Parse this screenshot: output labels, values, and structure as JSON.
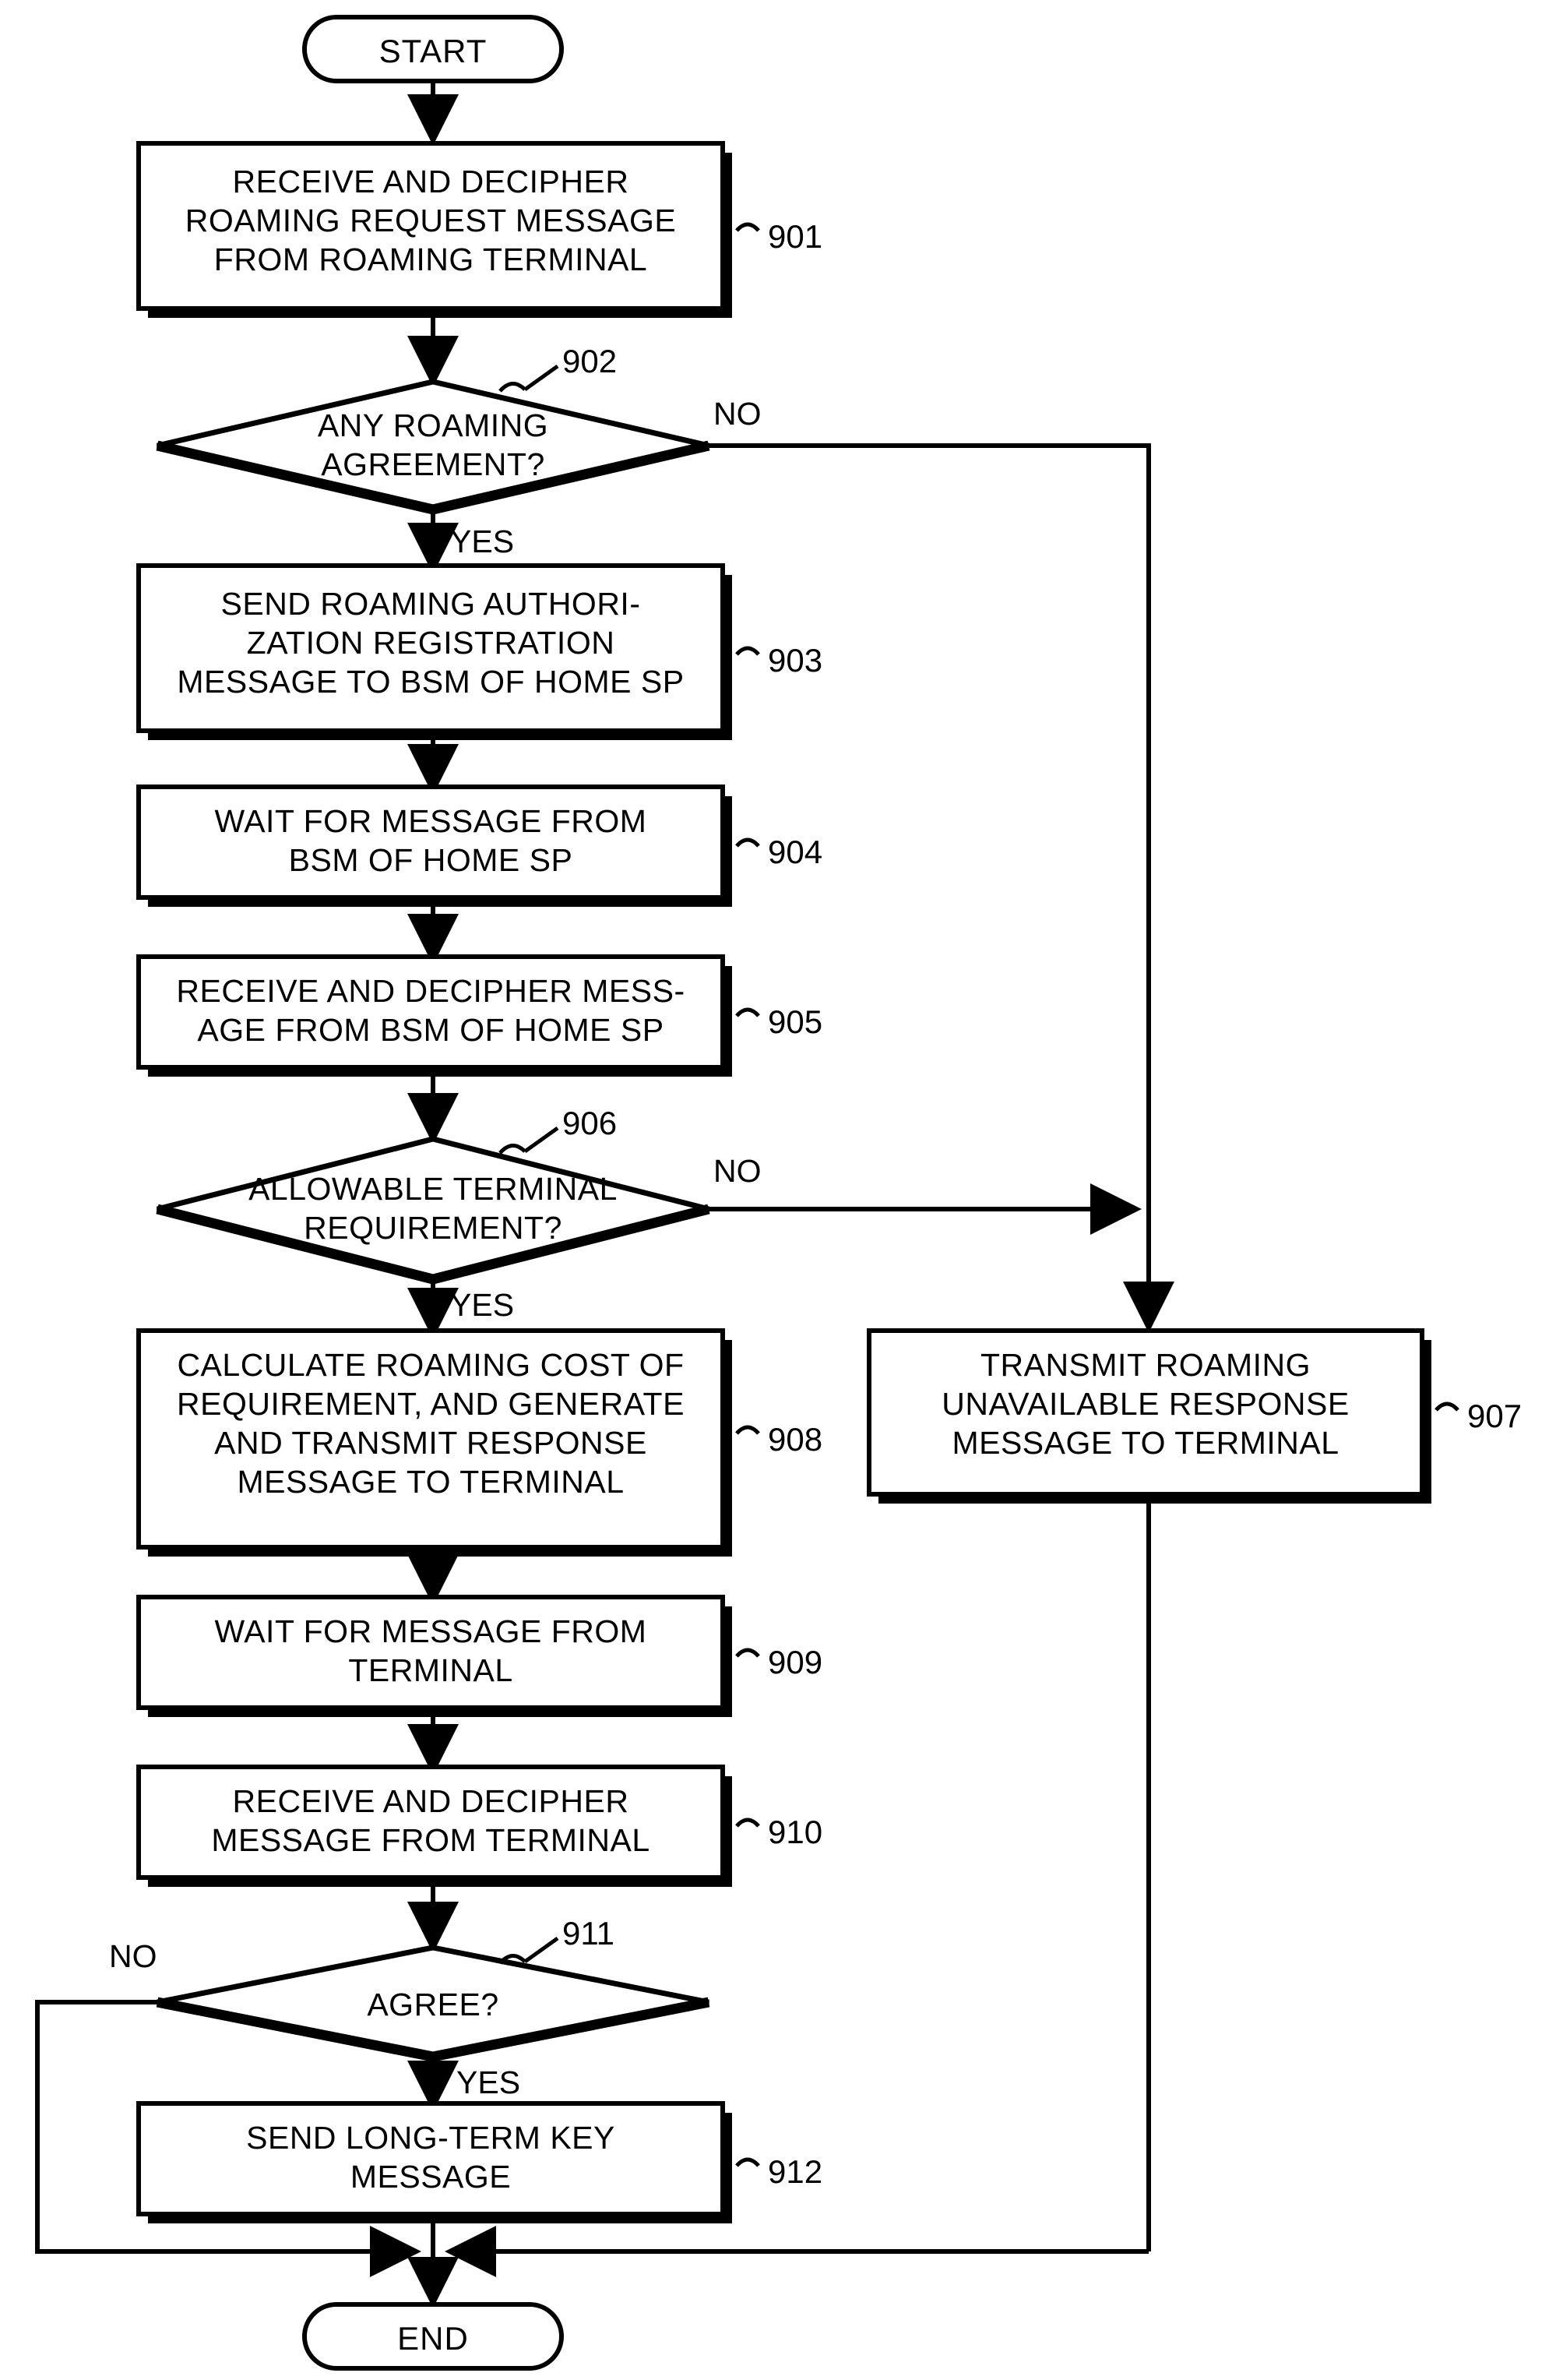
{
  "diagram": {
    "type": "flowchart",
    "title": "",
    "nodes": [
      {
        "id": "start",
        "shape": "terminator",
        "text": "START"
      },
      {
        "id": "n901",
        "shape": "process",
        "text": "RECEIVE AND DECIPHER\nROAMING REQUEST MESSAGE\nFROM ROAMING TERMINAL",
        "ref": "901"
      },
      {
        "id": "n902",
        "shape": "decision",
        "text": "ANY ROAMING\nAGREEMENT?",
        "ref": "902"
      },
      {
        "id": "n903",
        "shape": "process",
        "text": "SEND ROAMING AUTHORI-\nZATION REGISTRATION\nMESSAGE TO BSM OF HOME SP",
        "ref": "903"
      },
      {
        "id": "n904",
        "shape": "process",
        "text": "WAIT FOR MESSAGE FROM\nBSM OF HOME SP",
        "ref": "904"
      },
      {
        "id": "n905",
        "shape": "process",
        "text": "RECEIVE AND DECIPHER MESS-\nAGE FROM BSM OF HOME SP",
        "ref": "905"
      },
      {
        "id": "n906",
        "shape": "decision",
        "text": "ALLOWABLE TERMINAL\nREQUIREMENT?",
        "ref": "906"
      },
      {
        "id": "n908",
        "shape": "process",
        "text": "CALCULATE ROAMING COST OF\nREQUIREMENT, AND GENERATE\nAND TRANSMIT RESPONSE\nMESSAGE TO TERMINAL",
        "ref": "908"
      },
      {
        "id": "n907",
        "shape": "process",
        "text": "TRANSMIT ROAMING\nUNAVAILABLE RESPONSE\nMESSAGE TO TERMINAL",
        "ref": "907"
      },
      {
        "id": "n909",
        "shape": "process",
        "text": "WAIT FOR MESSAGE FROM\nTERMINAL",
        "ref": "909"
      },
      {
        "id": "n910",
        "shape": "process",
        "text": "RECEIVE AND DECIPHER\nMESSAGE FROM TERMINAL",
        "ref": "910"
      },
      {
        "id": "n911",
        "shape": "decision",
        "text": "AGREE?",
        "ref": "911"
      },
      {
        "id": "n912",
        "shape": "process",
        "text": "SEND LONG-TERM KEY\nMESSAGE",
        "ref": "912"
      },
      {
        "id": "end",
        "shape": "terminator",
        "text": "END"
      }
    ],
    "edge_labels": {
      "e902_no": "NO",
      "e902_yes": "YES",
      "e906_no": "NO",
      "e906_yes": "YES",
      "e911_no": "NO",
      "e911_yes": "YES"
    },
    "colors": {
      "stroke": "#000000",
      "fill": "#ffffff",
      "shadow": "#000000"
    }
  }
}
